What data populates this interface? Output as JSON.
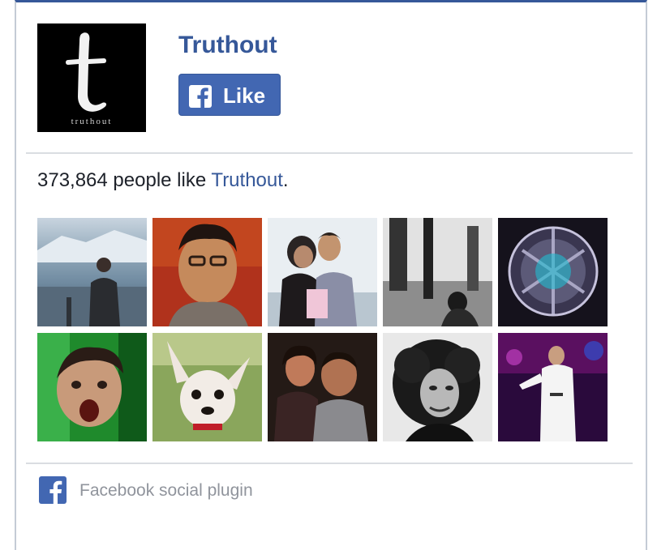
{
  "page": {
    "name": "Truthout",
    "logo_text": "truthout",
    "logo_letter": "t"
  },
  "like_button": {
    "label": "Like",
    "icon": "facebook-f-icon",
    "color": "#4267b2"
  },
  "social_context": {
    "count": "373,864",
    "text": " people like ",
    "page_link": "Truthout",
    "suffix": "."
  },
  "faces": [
    {
      "name": "friend-avatar-1"
    },
    {
      "name": "friend-avatar-2"
    },
    {
      "name": "friend-avatar-3"
    },
    {
      "name": "friend-avatar-4"
    },
    {
      "name": "friend-avatar-5"
    },
    {
      "name": "friend-avatar-6"
    },
    {
      "name": "friend-avatar-7"
    },
    {
      "name": "friend-avatar-8"
    },
    {
      "name": "friend-avatar-9"
    },
    {
      "name": "friend-avatar-10"
    }
  ],
  "footer": {
    "icon": "facebook-square-icon",
    "label": "Facebook social plugin"
  },
  "colors": {
    "brand_blue": "#365899",
    "button_blue": "#4267b2",
    "text_dark": "#1d2129",
    "text_grey": "#90949c",
    "divider": "#dadde1"
  }
}
